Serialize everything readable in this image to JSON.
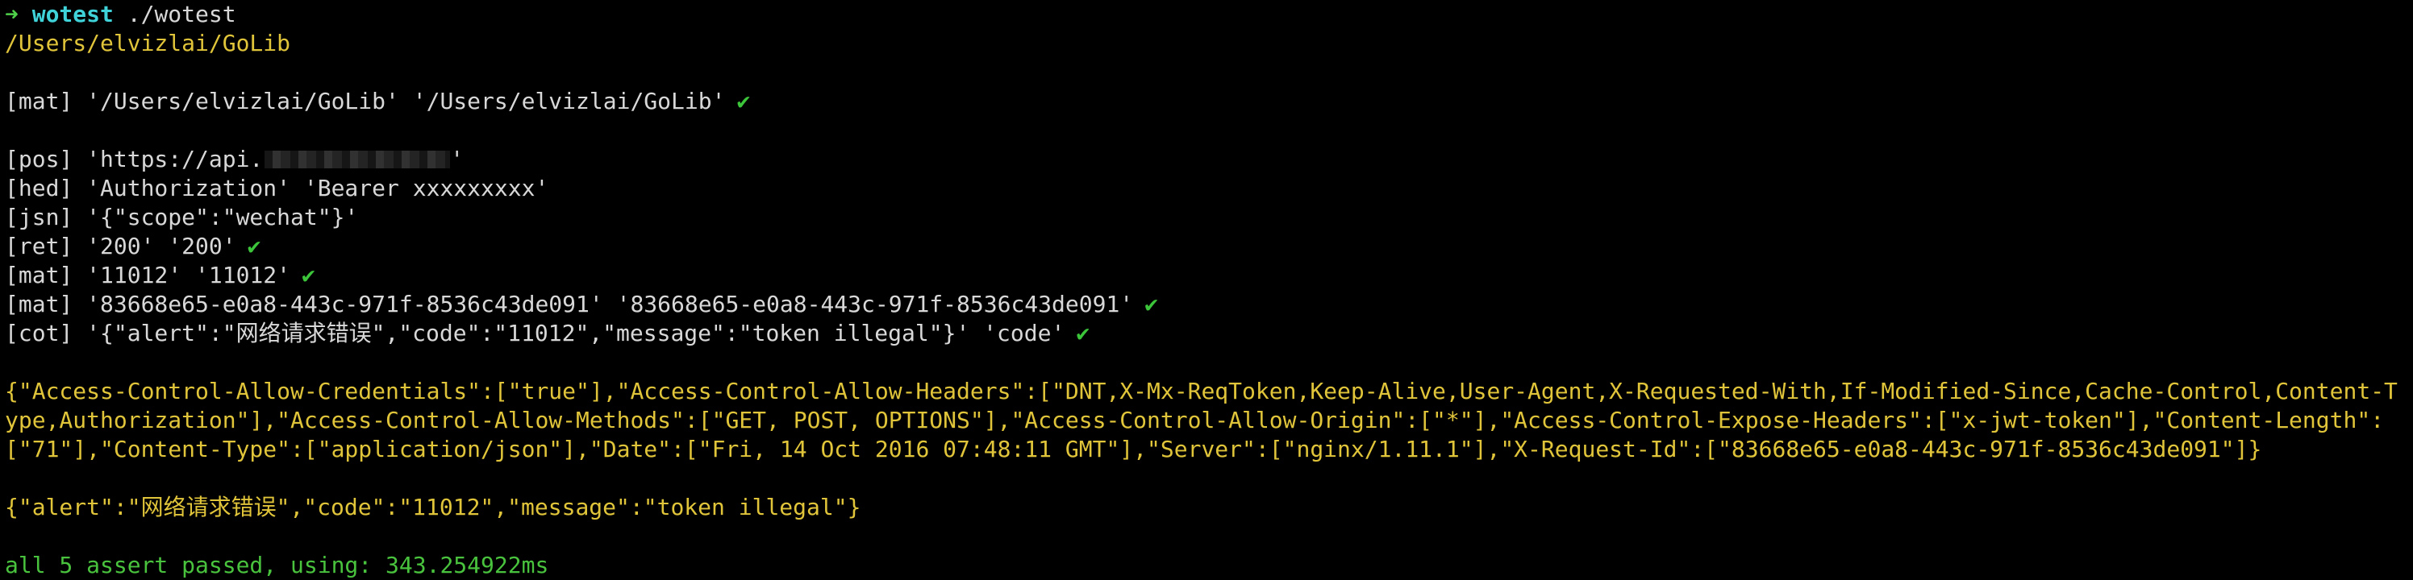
{
  "prompt": {
    "arrow": "➜",
    "dir": "wotest",
    "command": "./wotest"
  },
  "cwd": "/Users/elvizlai/GoLib",
  "lines": {
    "mat1": "[mat] '/Users/elvizlai/GoLib' '/Users/elvizlai/GoLib'",
    "pos_prefix": "[pos] 'https://api.",
    "pos_suffix": "'",
    "hed": "[hed] 'Authorization' 'Bearer xxxxxxxxx'",
    "jsn": "[jsn] '{\"scope\":\"wechat\"}'",
    "ret": "[ret] '200' '200'",
    "mat2": "[mat] '11012' '11012'",
    "mat3": "[mat] '83668e65-e0a8-443c-971f-8536c43de091' '83668e65-e0a8-443c-971f-8536c43de091'",
    "cot": "[cot] '{\"alert\":\"网络请求错误\",\"code\":\"11012\",\"message\":\"token illegal\"}' 'code'"
  },
  "check_mark": "✔",
  "headers_json": "{\"Access-Control-Allow-Credentials\":[\"true\"],\"Access-Control-Allow-Headers\":[\"DNT,X-Mx-ReqToken,Keep-Alive,User-Agent,X-Requested-With,If-Modified-Since,Cache-Control,Content-Type,Authorization\"],\"Access-Control-Allow-Methods\":[\"GET, POST, OPTIONS\"],\"Access-Control-Allow-Origin\":[\"*\"],\"Access-Control-Expose-Headers\":[\"x-jwt-token\"],\"Content-Length\":[\"71\"],\"Content-Type\":[\"application/json\"],\"Date\":[\"Fri, 14 Oct 2016 07:48:11 GMT\"],\"Server\":[\"nginx/1.11.1\"],\"X-Request-Id\":[\"83668e65-e0a8-443c-971f-8536c43de091\"]}",
  "body_json": "{\"alert\":\"网络请求错误\",\"code\":\"11012\",\"message\":\"token illegal\"}",
  "summary": "all 5 assert passed, using: 343.254922ms",
  "colors": {
    "background": "#000000",
    "text": "#d8d8d8",
    "yellow": "#e0c43a",
    "cyan": "#3fd2d8",
    "green": "#49c23d"
  }
}
